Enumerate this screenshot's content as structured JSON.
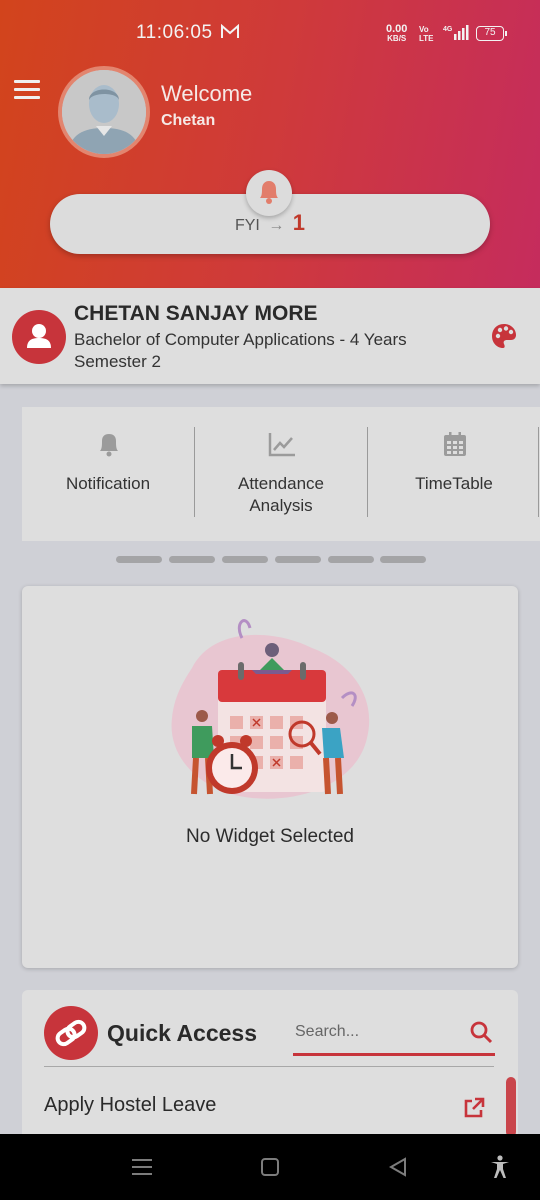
{
  "status_bar": {
    "time": "11:06:05",
    "speed_value": "0.00",
    "speed_unit": "KB/S",
    "volte_top": "Vo",
    "volte_bottom": "LTE",
    "network": "4G",
    "battery": "75"
  },
  "header": {
    "welcome": "Welcome",
    "user_first_name": "Chetan",
    "fyi_label": "FYI",
    "fyi_arrow": "→",
    "fyi_count": "1"
  },
  "student": {
    "name": "CHETAN SANJAY MORE",
    "course": "Bachelor of Computer Applications - 4 Years",
    "semester": "Semester 2"
  },
  "tiles": [
    {
      "label": "Notification",
      "icon": "bell-icon"
    },
    {
      "label": "Attendance\nAnalysis",
      "icon": "chart-line-icon"
    },
    {
      "label": "TimeTable",
      "icon": "calendar-icon"
    }
  ],
  "carousel": {
    "page_count": 6
  },
  "widget": {
    "empty_text": "No Widget Selected"
  },
  "quick_access": {
    "title": "Quick Access",
    "search_placeholder": "Search...",
    "items": [
      {
        "label": "Apply Hostel Leave"
      }
    ]
  },
  "colors": {
    "header_start": "#d2441c",
    "header_end": "#c52c5d",
    "accent": "#c7343b",
    "card_bg": "#dedede"
  }
}
